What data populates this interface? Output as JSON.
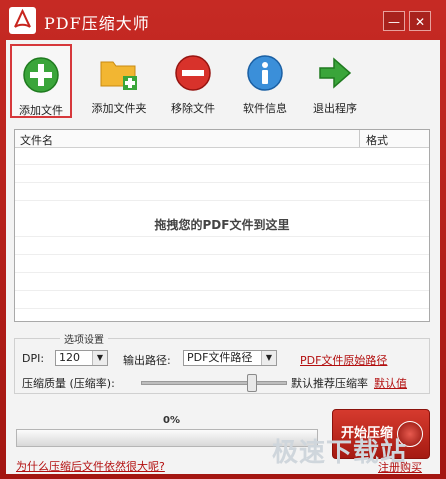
{
  "window": {
    "title": "PDF压缩大师",
    "minimize": "—",
    "close": "✕"
  },
  "toolbar": {
    "add_file": "添加文件",
    "add_folder": "添加文件夹",
    "remove_file": "移除文件",
    "software_info": "软件信息",
    "exit": "退出程序"
  },
  "filelist": {
    "columns": [
      "文件名",
      "格式"
    ],
    "drop_hint": "拖拽您的PDF文件到这里"
  },
  "options": {
    "group_label": "选项设置",
    "dpi_label": "DPI:",
    "dpi_value": "120",
    "output_label": "输出路径:",
    "output_value": "PDF文件路径",
    "output_link": "PDF文件原始路径",
    "quality_label": "压缩质量 (压缩率):",
    "quality_level": 0.78,
    "quality_hint": "默认推荐压缩率",
    "default_link": "默认值"
  },
  "progress": {
    "percent_text": "0%",
    "fraction": 0
  },
  "start_button": "开始压缩",
  "footer": {
    "why_link": "为什么压缩后文件依然很大呢?",
    "buy_link": "注册购买"
  },
  "watermark": "极速下载站"
}
